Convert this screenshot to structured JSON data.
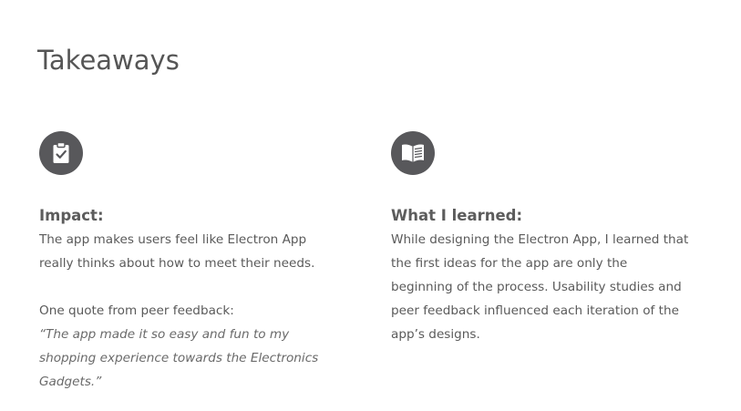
{
  "page": {
    "title": "Takeaways"
  },
  "impact": {
    "icon": "clipboard-check-icon",
    "heading": "Impact:",
    "paragraph": "The app makes users feel like Electron App really thinks about how to meet their needs.",
    "quote_label": "One quote from peer feedback:",
    "quote_text": "“The app made it so easy and fun to my shopping experience towards the Electronics Gadgets.”"
  },
  "learned": {
    "icon": "open-book-icon",
    "heading": "What I learned:",
    "paragraph": "While designing the Electron App, I learned that the first ideas for the app are only the beginning of the process. Usability studies and peer feedback influenced each iteration of the app’s designs."
  },
  "colors": {
    "icon_background": "#58585b",
    "text": "#5a5a5a",
    "background": "#ffffff"
  }
}
